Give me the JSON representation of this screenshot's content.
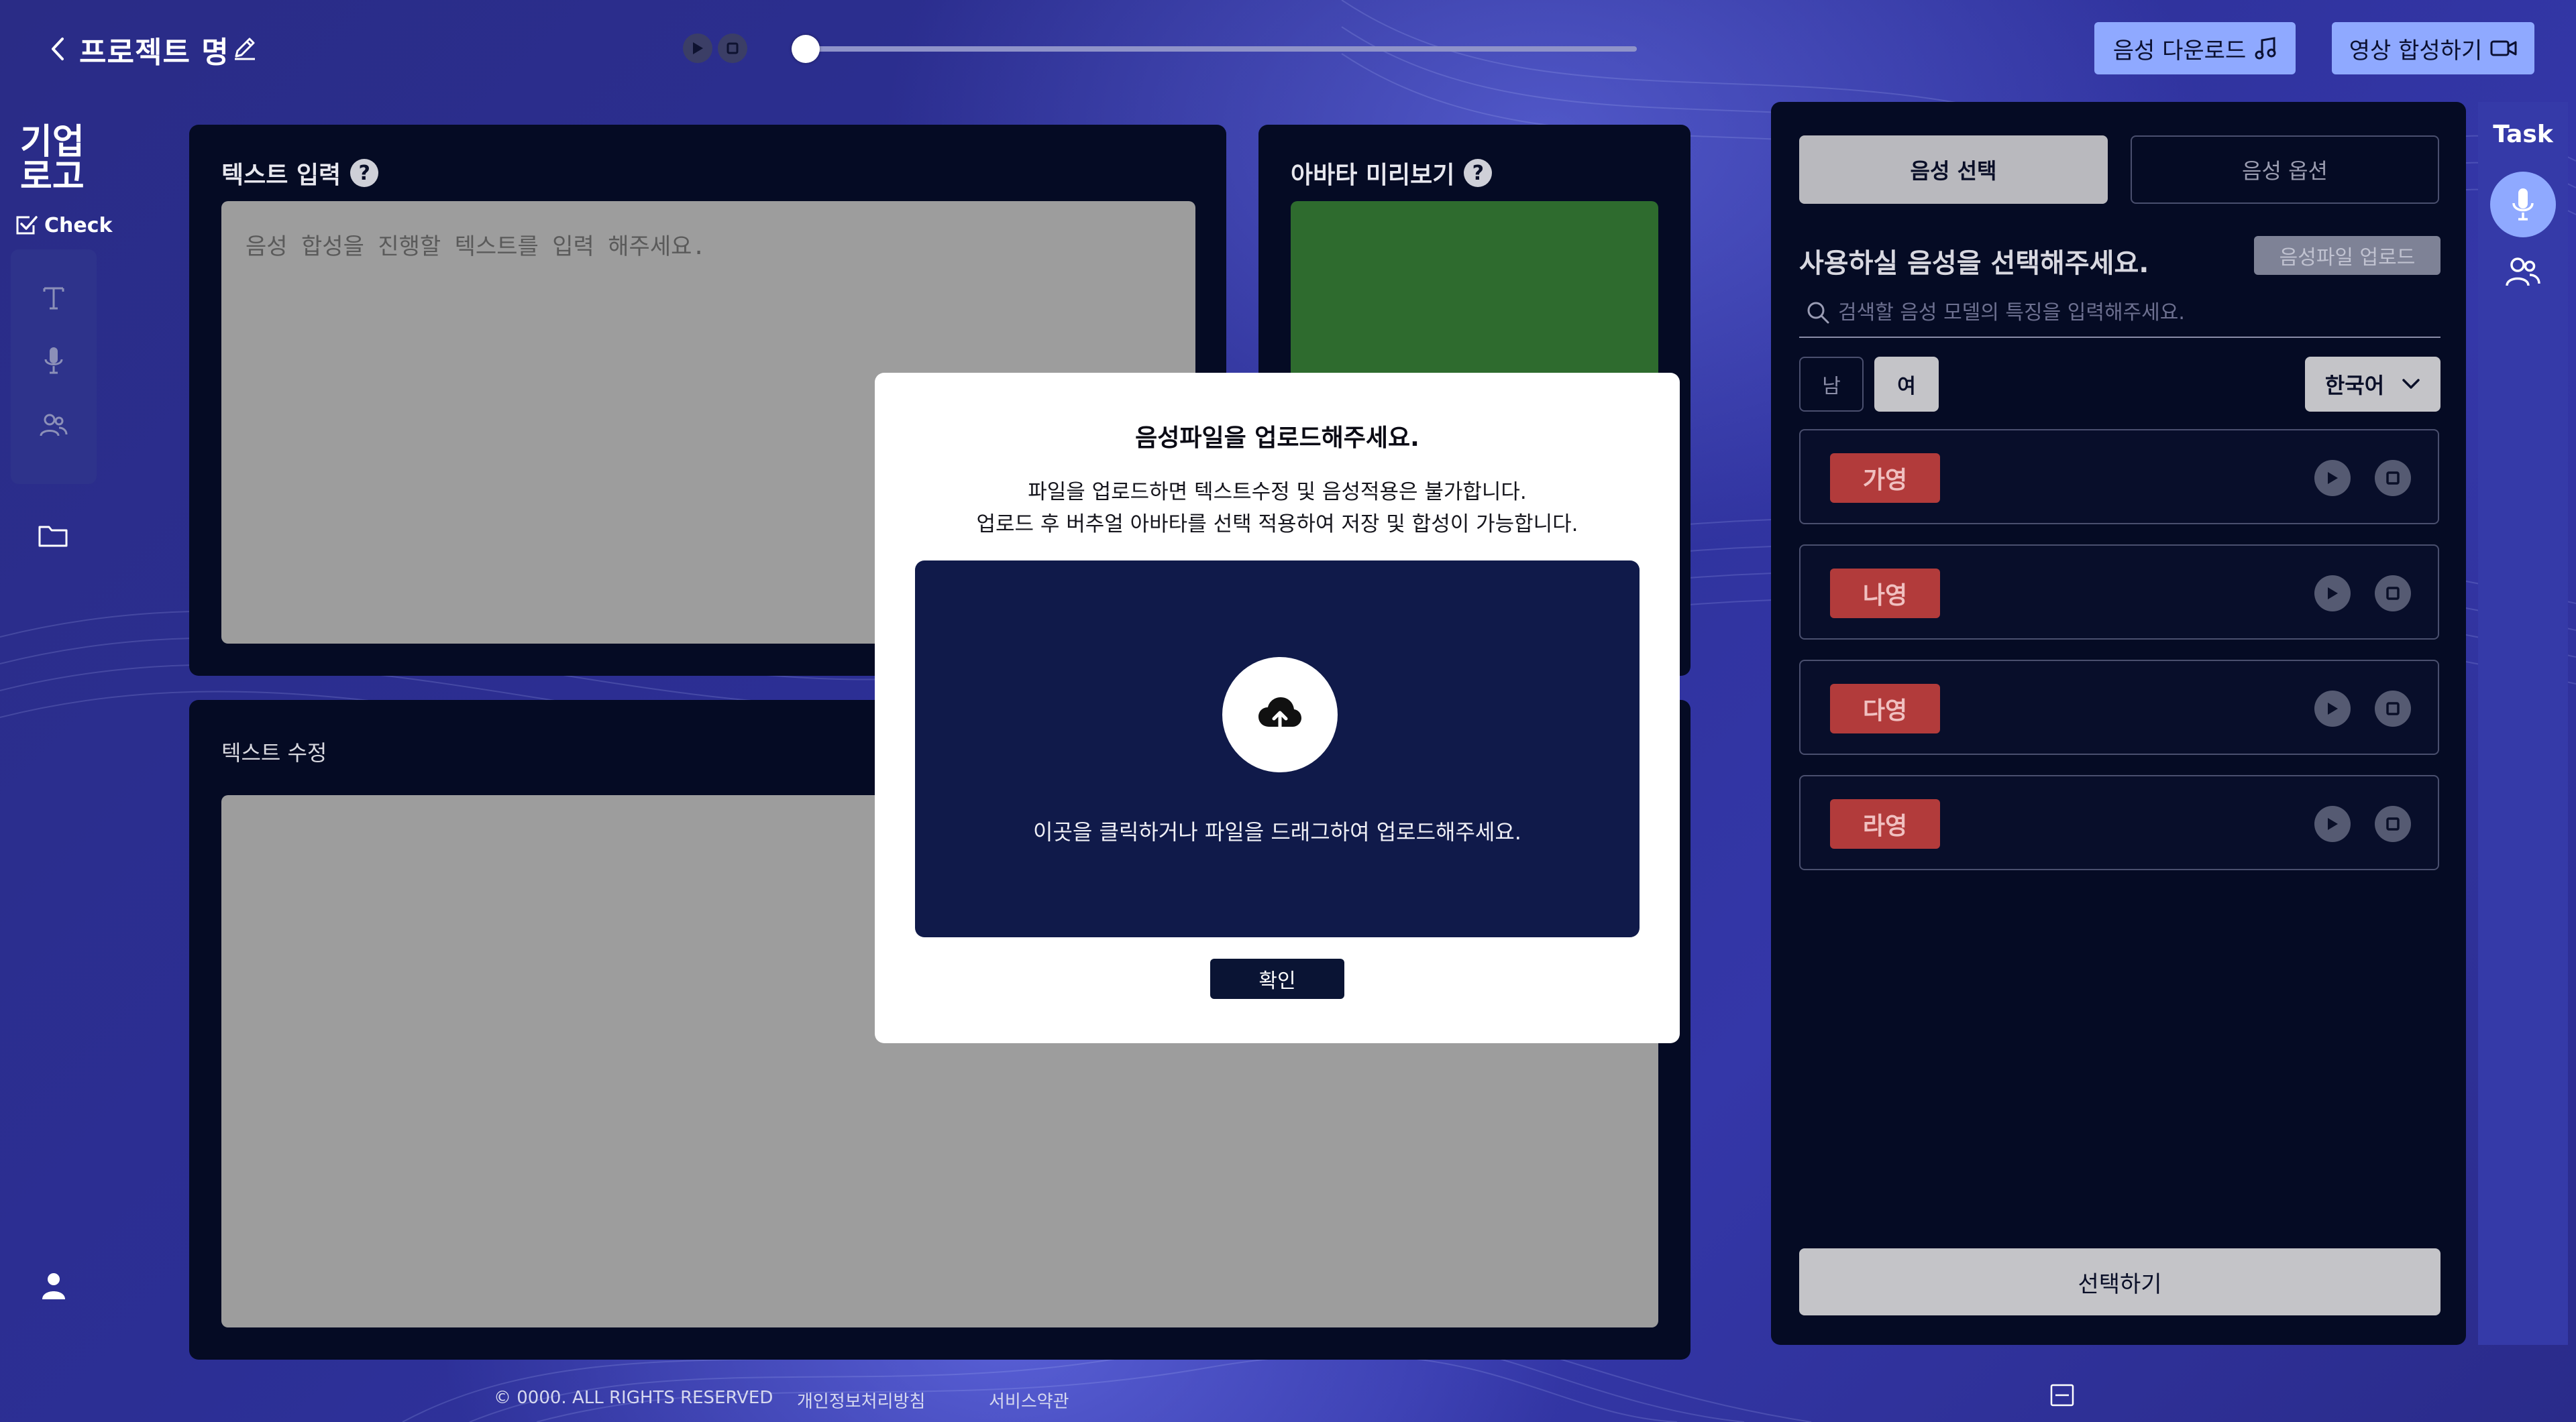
{
  "header": {
    "project_title": "프로젝트 명",
    "download_audio_label": "음성 다운로드",
    "compose_video_label": "영상 합성하기",
    "playback_progress": 0.01
  },
  "sidebar": {
    "logo": "기업\n로고",
    "check_label": "Check",
    "tools": [
      "text-tool",
      "voice-tool",
      "avatar-tool"
    ]
  },
  "text_input": {
    "title": "텍스트 입력",
    "placeholder": "음성 합성을 진행할 텍스트를 입력 해주세요."
  },
  "avatar_preview": {
    "title": "아바타 미리보기",
    "color": "#2e6b2e"
  },
  "text_edit": {
    "title": "텍스트 수정"
  },
  "voice_panel": {
    "tabs": [
      "음성 선택",
      "음성 옵션"
    ],
    "heading": "사용하실 음성을 선택해주세요.",
    "upload_label": "음성파일 업로드",
    "search_placeholder": "검색할 음성 모델의 특징을 입력해주세요.",
    "gender_male": "남",
    "gender_female": "여",
    "language": "한국어",
    "voices": [
      {
        "name": "가영"
      },
      {
        "name": "나영"
      },
      {
        "name": "다영"
      },
      {
        "name": "라영"
      }
    ],
    "select_button": "선택하기"
  },
  "task_rail": {
    "label": "Task"
  },
  "footer": {
    "copyright": "© 0000. ALL RIGHTS RESERVED",
    "privacy": "개인정보처리방침",
    "terms": "서비스약관"
  },
  "modal": {
    "title": "음성파일을 업로드해주세요.",
    "desc_line1": "파일을 업로드하면 텍스트수정 및 음성적용은 불가합니다.",
    "desc_line2": "업로드 후 버추얼 아바타를 선택 적용하여 저장 및 합성이 가능합니다.",
    "drop_text": "이곳을 클릭하거나 파일을 드래그하여 업로드해주세요.",
    "confirm_label": "확인"
  },
  "colors": {
    "accent": "#8fa9ff",
    "panel_bg": "#050b24",
    "badge_red": "#b23b3b"
  }
}
